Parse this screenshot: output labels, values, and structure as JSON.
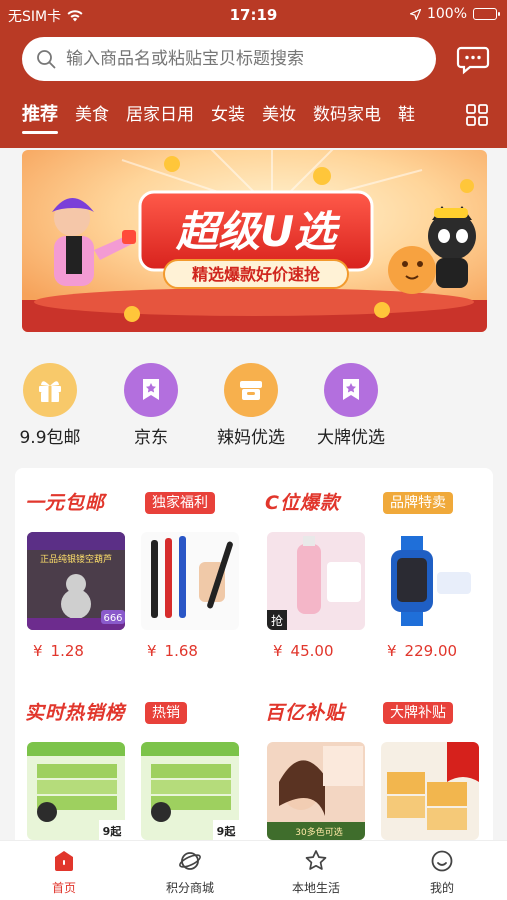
{
  "status_bar": {
    "carrier": "无SIM卡",
    "time": "17:19",
    "battery": "100%"
  },
  "search": {
    "placeholder": "输入商品名或粘贴宝贝标题搜索"
  },
  "tabs": [
    "推荐",
    "美食",
    "居家日用",
    "女装",
    "美妆",
    "数码家电",
    "鞋"
  ],
  "banner": {
    "title": "超级U选",
    "subtitle": "精选爆款好价速抢"
  },
  "quick_links": [
    {
      "label": "9.9包邮",
      "icon": "gift-icon"
    },
    {
      "label": "京东",
      "icon": "star-bookmark-icon"
    },
    {
      "label": "辣妈优选",
      "icon": "box-icon"
    },
    {
      "label": "大牌优选",
      "icon": "star-bookmark-icon"
    }
  ],
  "sections": [
    {
      "title": "一元包邮",
      "badge": "独家福利",
      "badge_color": "#e8413a",
      "products": [
        {
          "price": "1.28",
          "thumb_text": "正品纯银镂空葫芦",
          "thumb_tag": "666"
        },
        {
          "price": "1.68"
        }
      ]
    },
    {
      "title": "C位爆款",
      "badge": "品牌特卖",
      "badge_color": "#f0a93a",
      "products": [
        {
          "price": "45.00",
          "thumb_text": "抢"
        },
        {
          "price": "229.00"
        }
      ]
    },
    {
      "title": "实时热销榜",
      "badge": "热销",
      "badge_color": "#e8413a",
      "products": [
        {
          "price": "",
          "thumb_text": "9起"
        },
        {
          "price": "",
          "thumb_text": "9起"
        }
      ]
    },
    {
      "title": "百亿补贴",
      "badge": "大牌补贴",
      "badge_color": "#e8413a",
      "products": [
        {
          "price": "",
          "thumb_text": "30多色可选"
        },
        {
          "price": ""
        }
      ]
    }
  ],
  "currency_symbol": "¥",
  "tabbar": [
    {
      "label": "首页",
      "icon": "home-icon"
    },
    {
      "label": "积分商城",
      "icon": "planet-icon"
    },
    {
      "label": "本地生活",
      "icon": "star-icon"
    },
    {
      "label": "我的",
      "icon": "smile-icon"
    }
  ],
  "colors": {
    "header": "#b93a25",
    "accent": "#e1362c"
  }
}
